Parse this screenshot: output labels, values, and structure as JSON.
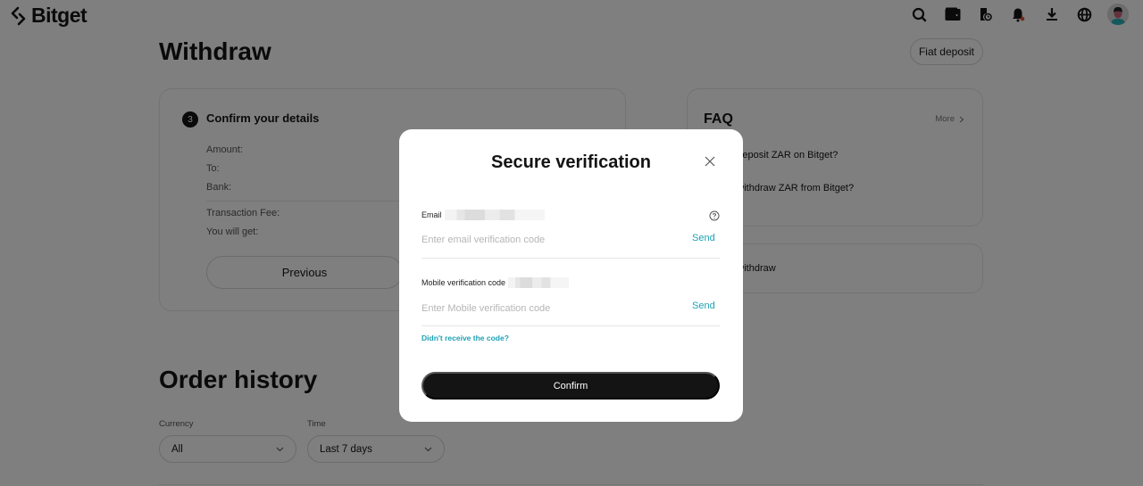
{
  "header": {
    "brand": "Bitget",
    "icons": [
      "search-icon",
      "wallet-icon",
      "orders-icon",
      "bell-icon",
      "download-icon",
      "globe-icon",
      "avatar"
    ]
  },
  "withdraw": {
    "title": "Withdraw",
    "fiat_deposit_label": "Fiat deposit",
    "step_number": "3",
    "step_title": "Confirm your details",
    "details": [
      "Amount:",
      "To:",
      "Bank:"
    ],
    "fees": [
      "Transaction Fee:",
      "You will get:"
    ],
    "previous_label": "Previous"
  },
  "faq": {
    "title": "FAQ",
    "more_label": "More",
    "items": [
      "How to deposit ZAR on Bitget?",
      "How to withdraw ZAR from Bitget?"
    ],
    "guide": "How to withdraw"
  },
  "order_history": {
    "title": "Order history",
    "currency_label": "Currency",
    "currency_value": "All",
    "time_label": "Time",
    "time_value": "Last 7 days"
  },
  "modal": {
    "title": "Secure verification",
    "email_label": "Email",
    "email_placeholder": "Enter email verification code",
    "email_value": "",
    "send_label": "Send",
    "mobile_label": "Mobile verification code",
    "mobile_placeholder": "Enter Mobile verification code",
    "mobile_value": "",
    "didnt_receive": "Didn't receive the code?",
    "confirm_label": "Confirm"
  },
  "colors": {
    "accent": "#1da2b4",
    "primary_button": "#141414",
    "overlay": "rgba(0,0,0,0.5)"
  }
}
